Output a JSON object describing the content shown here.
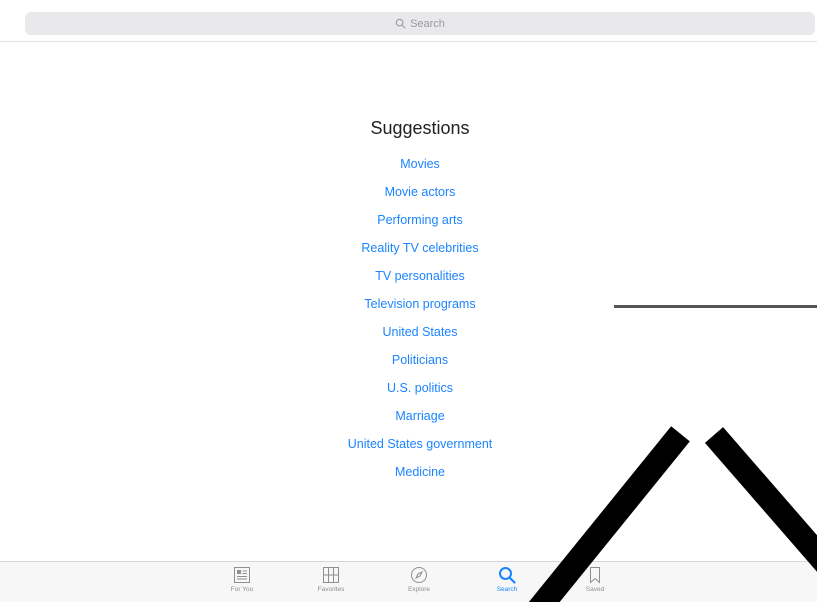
{
  "search": {
    "placeholder": "Search"
  },
  "suggestions": {
    "title": "Suggestions",
    "items": [
      "Movies",
      "Movie actors",
      "Performing arts",
      "Reality TV celebrities",
      "TV personalities",
      "Television programs",
      "United States",
      "Politicians",
      "U.S. politics",
      "Marriage",
      "United States government",
      "Medicine"
    ]
  },
  "tabs": [
    {
      "label": "For You",
      "icon": "for-you-icon"
    },
    {
      "label": "Favorites",
      "icon": "favorites-grid-icon"
    },
    {
      "label": "Explore",
      "icon": "compass-icon"
    },
    {
      "label": "Search",
      "icon": "search-icon",
      "active": true
    },
    {
      "label": "Saved",
      "icon": "bookmark-icon"
    }
  ],
  "colors": {
    "accent": "#1a84ff",
    "inactive": "#8e8e93"
  }
}
